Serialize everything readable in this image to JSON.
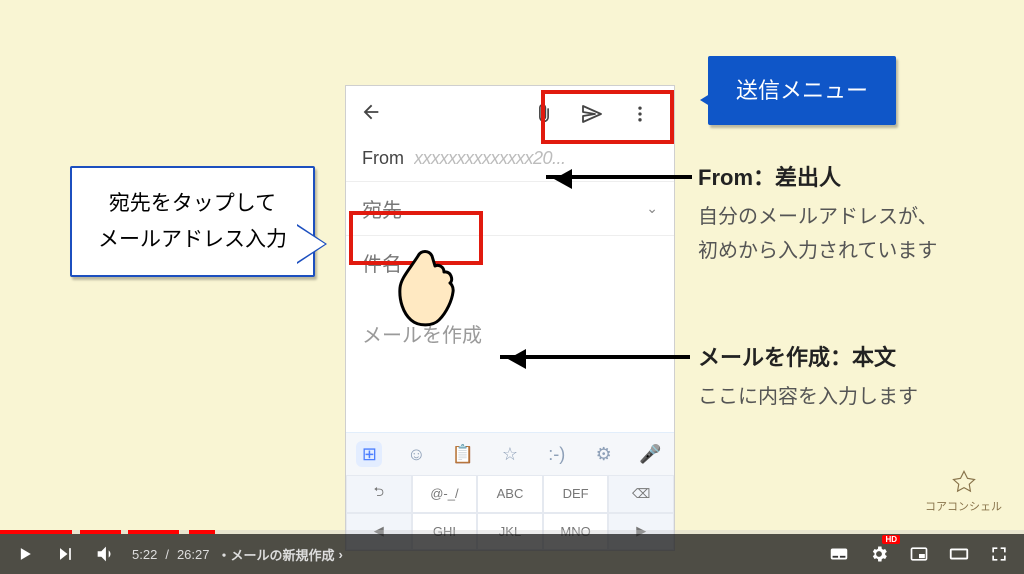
{
  "callout_left": {
    "line1": "宛先をタップして",
    "line2": "メールアドレス入力"
  },
  "callout_blue": {
    "text": "送信メニュー"
  },
  "anno": {
    "from_title": "From：差出人",
    "from_sub_l1": "自分のメールアドレスが、",
    "from_sub_l2": "初めから入力されています",
    "body_title": "メールを作成：本文",
    "body_sub": "ここに内容を入力します"
  },
  "phone": {
    "from_label": "From",
    "from_value": "xxxxxxxxxxxxxx20...",
    "to_label": "宛先",
    "subject_label": "件名",
    "body_placeholder": "メールを作成",
    "keyboard": {
      "row1": [
        "⮌",
        "@-_/",
        "ABC",
        "DEF",
        "⌫"
      ],
      "row2": [
        "◀",
        "GHI",
        "JKL",
        "MNO",
        "▶"
      ]
    }
  },
  "logo": {
    "text": "コアコンシェル"
  },
  "video": {
    "current_time": "5:22",
    "duration": "26:27",
    "chapter": "・メールの新規作成",
    "chapter_chevron": "›",
    "played_pct": 21
  }
}
